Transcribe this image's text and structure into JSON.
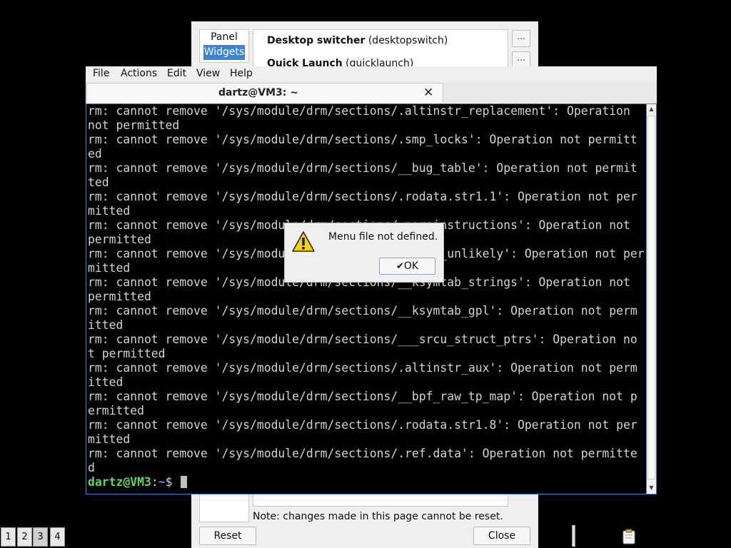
{
  "prefs": {
    "categories": [
      "Panel",
      "Widgets"
    ],
    "widgets": [
      {
        "name": "Desktop switcher",
        "id": "(desktopswitch)"
      },
      {
        "name": "Quick Launch",
        "id": "(quicklaunch)"
      }
    ],
    "more_label": "...",
    "note": "Note: changes made in this page cannot be reset.",
    "reset_label": "Reset",
    "close_label": "Close"
  },
  "terminal": {
    "menu": [
      "File",
      "Actions",
      "Edit",
      "View",
      "Help"
    ],
    "tab_title": "dartz@VM3: ~",
    "lines": [
      "rm: cannot remove '/sys/module/drm/sections/.altinstr_replacement': Operation",
      "not permitted",
      "rm: cannot remove '/sys/module/drm/sections/.smp_locks': Operation not permitt",
      "ed",
      "rm: cannot remove '/sys/module/drm/sections/__bug_table': Operation not permit",
      "ted",
      "rm: cannot remove '/sys/module/drm/sections/.rodata.str1.1': Operation not per",
      "mitted",
      "rm: cannot remove '/sys/module/drm/sections/.parainstructions': Operation not",
      "permitted",
      "rm: cannot remove '/sys/module/drm/sections/__jump_unlikely': Operation not per",
      "mitted",
      "rm: cannot remove '/sys/module/drm/sections/__ksymtab_strings': Operation not",
      "permitted",
      "rm: cannot remove '/sys/module/drm/sections/__ksymtab_gpl': Operation not perm",
      "itted",
      "rm: cannot remove '/sys/module/drm/sections/___srcu_struct_ptrs': Operation no",
      "t permitted",
      "rm: cannot remove '/sys/module/drm/sections/.altinstr_aux': Operation not perm",
      "itted",
      "rm: cannot remove '/sys/module/drm/sections/__bpf_raw_tp_map': Operation not p",
      "ermitted",
      "rm: cannot remove '/sys/module/drm/sections/.rodata.str1.8': Operation not per",
      "mitted",
      "rm: cannot remove '/sys/module/drm/sections/.ref.data': Operation not permitte",
      "d"
    ],
    "prompt_user": "dartz@VM3",
    "prompt_sep": ":",
    "prompt_path": "~",
    "prompt_symbol": "$"
  },
  "dialog": {
    "message": "Menu file not defined.",
    "ok_label": "OK"
  },
  "taskbar": {
    "desktops": [
      "1",
      "2",
      "3",
      "4"
    ],
    "active_desktop": "3"
  },
  "colors": {
    "selection": "#3b84d9",
    "prompt_user": "#5fd75f",
    "prompt_path": "#5f87ff",
    "terminal_bg": "#000000",
    "terminal_fg": "#d3d3d3"
  }
}
